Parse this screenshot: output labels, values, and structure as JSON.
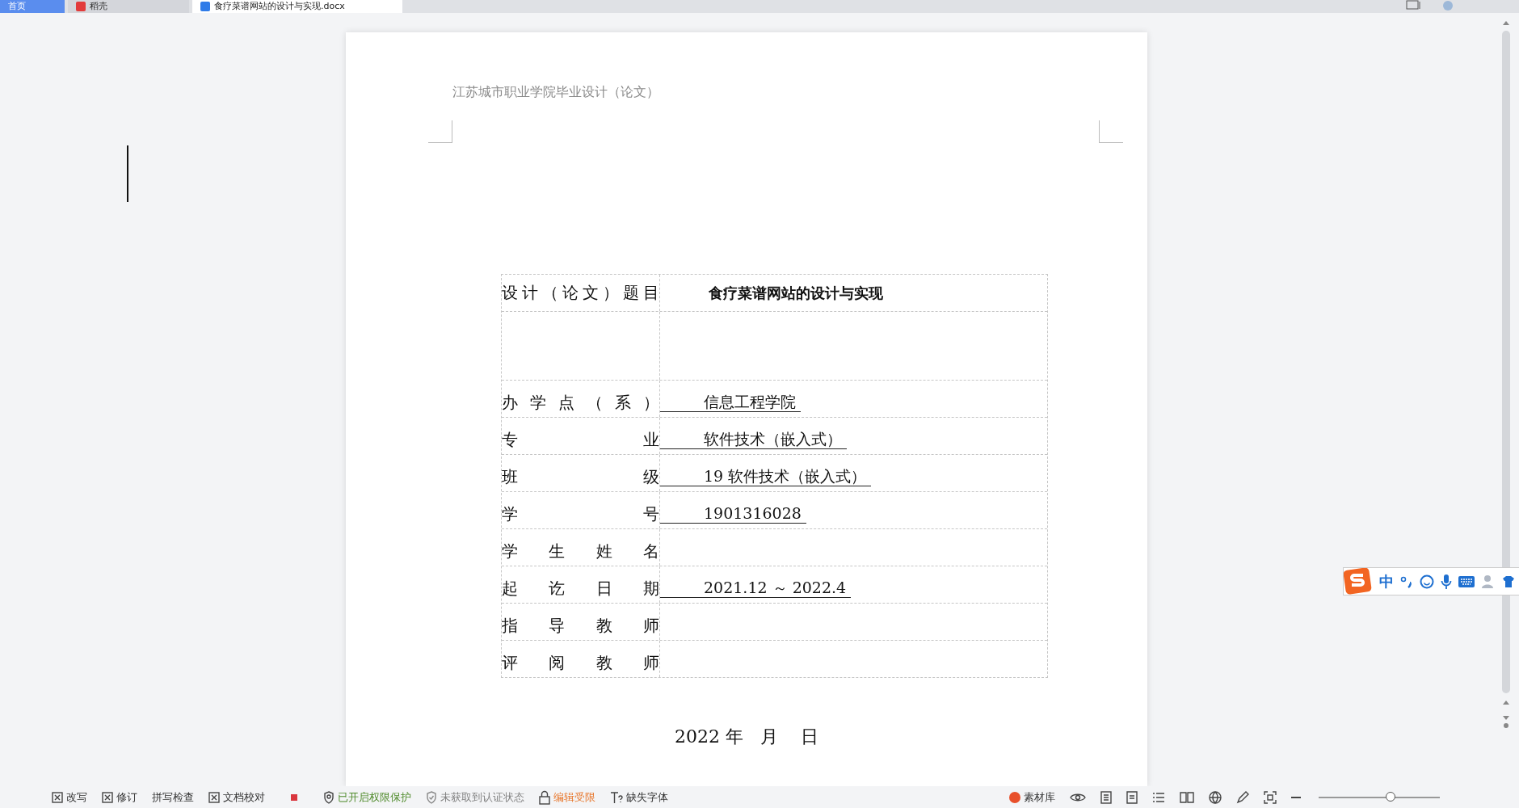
{
  "tabs": [
    {
      "label": "首页",
      "selected": false,
      "kind": "home"
    },
    {
      "label": "稻壳",
      "selected": false,
      "kind": "docer"
    },
    {
      "label": "食疗菜谱网站的设计与实现.docx",
      "selected": true,
      "kind": "document"
    }
  ],
  "document": {
    "header": "江苏城市职业学院毕业设计（论文）",
    "table": [
      {
        "kind": "title",
        "label": "设计（论文）题目",
        "value": "食疗菜谱网站的设计与实现"
      },
      {
        "kind": "blank"
      },
      {
        "kind": "field",
        "label": "办学点（系）",
        "value": "信息工程学院"
      },
      {
        "kind": "field",
        "label": "专业",
        "value": "软件技术（嵌入式）"
      },
      {
        "kind": "field",
        "label": "班级",
        "value": "19 软件技术（嵌入式）"
      },
      {
        "kind": "field",
        "label": "学号",
        "value": "1901316028"
      },
      {
        "kind": "field",
        "label": "学生姓名"
      },
      {
        "kind": "field",
        "label": "起讫日期",
        "value": "2021.12 ～ 2022.4"
      },
      {
        "kind": "field",
        "label": "指导教师"
      },
      {
        "kind": "field",
        "label": "评阅教师"
      }
    ],
    "date": "2022 年   月    日"
  },
  "status_bar": {
    "items": [
      {
        "kind": "check",
        "label": "改写"
      },
      {
        "kind": "check",
        "label": "修订"
      },
      {
        "kind": "plain",
        "label": "拼写检查"
      },
      {
        "kind": "check",
        "label": "文档校对"
      },
      {
        "kind": "record"
      },
      {
        "kind": "shield-key",
        "label": "已开启权限保护",
        "color": "#4f8a2b"
      },
      {
        "kind": "shield-check",
        "label": "未获取到认证状态",
        "color": "#808080"
      },
      {
        "kind": "lock",
        "label": "编辑受限",
        "color": "#e8762b"
      },
      {
        "kind": "font",
        "label": "缺失字体",
        "color": "#333333"
      }
    ],
    "library": "素材库",
    "zoom": {
      "level": 0.6
    }
  },
  "ime": {
    "mode": "中"
  }
}
